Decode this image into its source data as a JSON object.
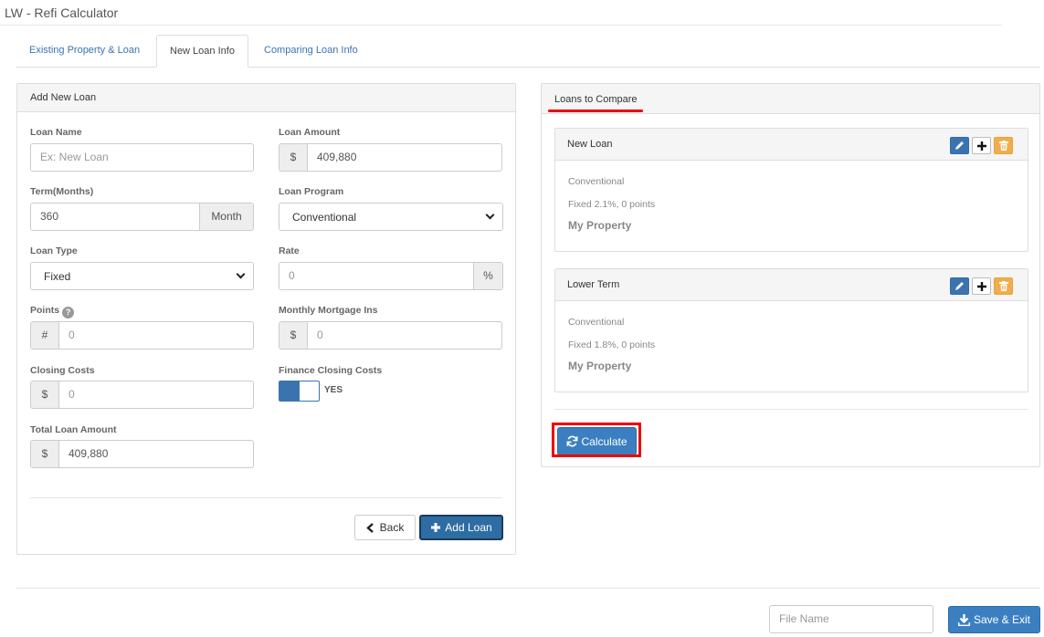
{
  "app": {
    "title": "LW - Refi Calculator"
  },
  "tabs": [
    {
      "label": "Existing Property & Loan",
      "active": false
    },
    {
      "label": "New Loan Info",
      "active": true
    },
    {
      "label": "Comparing Loan Info",
      "active": false
    }
  ],
  "add_loan": {
    "panel_title": "Add New Loan",
    "loan_name": {
      "label": "Loan Name",
      "placeholder": "Ex: New Loan",
      "value": ""
    },
    "loan_amount": {
      "label": "Loan Amount",
      "prefix": "$",
      "value": "409,880"
    },
    "term": {
      "label": "Term(Months)",
      "value": "360",
      "suffix": "Month"
    },
    "loan_program": {
      "label": "Loan Program",
      "selected": "Conventional"
    },
    "loan_type": {
      "label": "Loan Type",
      "selected": "Fixed"
    },
    "rate": {
      "label": "Rate",
      "placeholder": "0",
      "suffix": "%"
    },
    "points": {
      "label": "Points",
      "help": "?",
      "prefix": "#",
      "placeholder": "0"
    },
    "monthly_mortgage_ins": {
      "label": "Monthly Mortgage Ins",
      "prefix": "$",
      "placeholder": "0"
    },
    "closing_costs": {
      "label": "Closing Costs",
      "prefix": "$",
      "placeholder": "0"
    },
    "finance_closing_costs": {
      "label": "Finance Closing Costs",
      "toggle_text": "YES",
      "on": true
    },
    "total_loan_amount": {
      "label": "Total Loan Amount",
      "prefix": "$",
      "value": "409,880"
    },
    "back_label": "Back",
    "add_label": "Add Loan"
  },
  "compare": {
    "panel_title": "Loans to Compare",
    "loans": [
      {
        "name": "New Loan",
        "program": "Conventional",
        "terms": "Fixed 2.1%, 0 points",
        "property": "My Property"
      },
      {
        "name": "Lower Term",
        "program": "Conventional",
        "terms": "Fixed 1.8%, 0 points",
        "property": "My Property"
      }
    ],
    "calculate_label": "Calculate"
  },
  "footer": {
    "file_name_placeholder": "File Name",
    "save_label": "Save & Exit"
  },
  "colors": {
    "primary": "#2e6da4",
    "link": "#3b73af",
    "warning": "#f0ad4e",
    "highlight": "#ee0000"
  }
}
